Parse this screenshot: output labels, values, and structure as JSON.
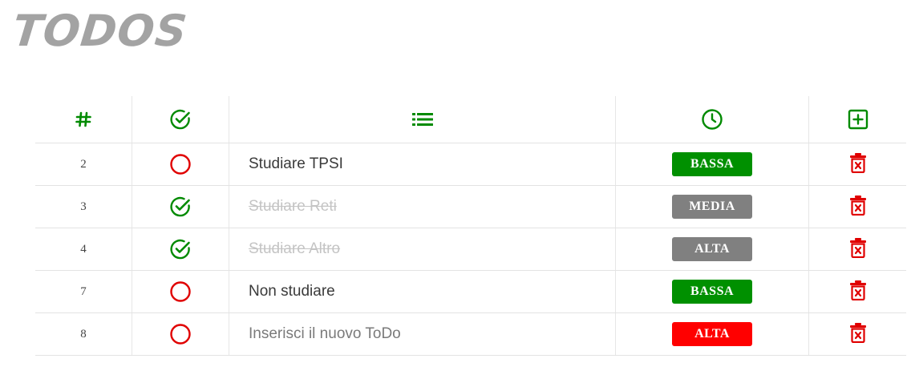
{
  "app": {
    "title": "TODOS"
  },
  "colors": {
    "green": "#008a00",
    "red": "#e00000",
    "gray": "#7f7f7f",
    "bright_red": "#ff0000"
  },
  "header": {
    "columns": [
      {
        "icon": "hash-icon"
      },
      {
        "icon": "check-circle-icon"
      },
      {
        "icon": "list-icon"
      },
      {
        "icon": "clock-icon"
      },
      {
        "icon": "plus-square-icon"
      }
    ]
  },
  "todos": [
    {
      "id": "2",
      "done": false,
      "text": "Studiare TPSI",
      "priority": "BASSA",
      "priority_color": "#009000"
    },
    {
      "id": "3",
      "done": true,
      "text": "Studiare Reti",
      "priority": "MEDIA",
      "priority_color": "#808080"
    },
    {
      "id": "4",
      "done": true,
      "text": "Studiare Altro",
      "priority": "ALTA",
      "priority_color": "#808080"
    },
    {
      "id": "7",
      "done": false,
      "text": "Non studiare",
      "priority": "BASSA",
      "priority_color": "#009000"
    },
    {
      "id": "8",
      "done": false,
      "text": "Inserisci il nuovo ToDo",
      "priority": "ALTA",
      "priority_color": "#ff0000",
      "is_input": true
    }
  ]
}
